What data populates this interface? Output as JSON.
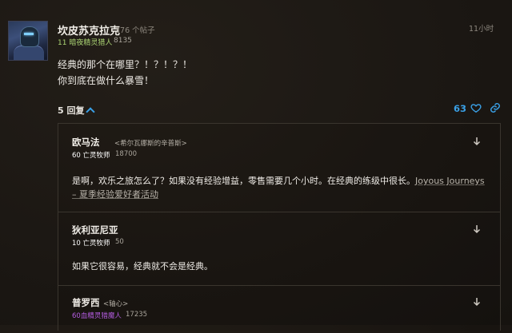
{
  "post": {
    "author": "坎皮苏克拉克",
    "post_count": "376 个帖子",
    "class_label": "11 暗夜精灵猎人",
    "points": "8135",
    "time_ago": "11小时",
    "body_lines": [
      "经典的那个在哪里？！？！？！",
      "你到底在做什么暴雪！"
    ],
    "replies_label": "5 回复",
    "likes": "63",
    "colors": {
      "accent": "#3aa0e6",
      "hunter": "#abd473",
      "priest": "#ffffff",
      "demon_hunter": "#a330c9"
    }
  },
  "replies": [
    {
      "author": "欧马法",
      "guild": "<希尔瓦娜斯的辛普斯>",
      "class_label": "60 亡灵牧师",
      "points": "18700",
      "text": "是啊，欢乐之旅怎么了？如果没有经验增益，零售需要几个小时。在经典的练级中很长。",
      "link_text": "Joyous Journeys – 夏季经验爱好者活动"
    },
    {
      "author": "狄利亚尼亚",
      "guild": "",
      "class_label": "10 亡灵牧师",
      "points": "50",
      "text": "如果它很容易，经典就不会是经典。",
      "link_text": ""
    },
    {
      "author": "普罗西",
      "guild": "<轴心>",
      "class_label": "60血精灵猎魔人",
      "points": "17235",
      "text": "",
      "link_text": ""
    }
  ]
}
